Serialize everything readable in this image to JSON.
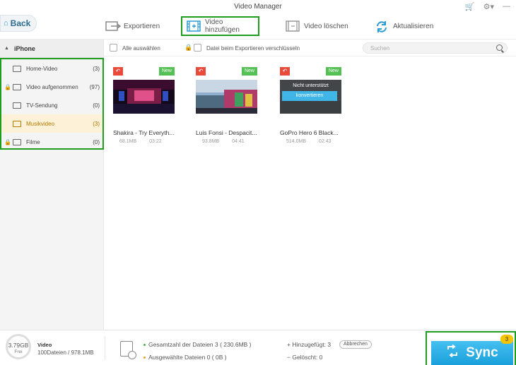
{
  "window": {
    "title": "Video Manager"
  },
  "toolbar": {
    "back_label": "Back",
    "export_label": "Exportieren",
    "add_video_label": "Video hinzufügen",
    "delete_label": "Video löschen",
    "refresh_label": "Aktualisieren"
  },
  "sidebar": {
    "device": "iPhone",
    "items": [
      {
        "label": "Home-Video",
        "count": "(3)"
      },
      {
        "label": "Video aufgenommen",
        "count": "(97)"
      },
      {
        "label": "TV-Sendung",
        "count": "(0)"
      },
      {
        "label": "Musikvideo",
        "count": "(3)"
      },
      {
        "label": "Filme",
        "count": "(0)"
      }
    ]
  },
  "filter": {
    "select_all": "Alle auswählen",
    "encrypt": "Datei beim Exportieren verschlüsseln",
    "search_placeholder": "Suchen"
  },
  "videos": [
    {
      "title": "Shakira - Try Everyth...",
      "size": "68.1MB",
      "duration": "03:22",
      "badge": "New"
    },
    {
      "title": "Luis Fonsi - Despacit...",
      "size": "93.8MB",
      "duration": "04:41",
      "badge": "New"
    },
    {
      "title": "GoPro Hero 6 Black...",
      "size": "514.0MB",
      "duration": "02:43",
      "badge": "New",
      "unsupported": "Nicht unterstützt",
      "convert": "konvertieren"
    }
  ],
  "bottom": {
    "free_gb": "3.79GB",
    "free_label": "Frei",
    "video_title": "Video",
    "video_stats": "100Dateien / 978.1MB",
    "total": "Gesamtzahl der Dateien 3 ( 230.6MB )",
    "selected": "Ausgewählte Dateien 0 ( 0B )",
    "added": "Hinzugefügt: 3",
    "deleted": "Gelöscht: 0",
    "cancel": "Abbrechen",
    "sync": "Sync",
    "sync_badge": "3"
  }
}
